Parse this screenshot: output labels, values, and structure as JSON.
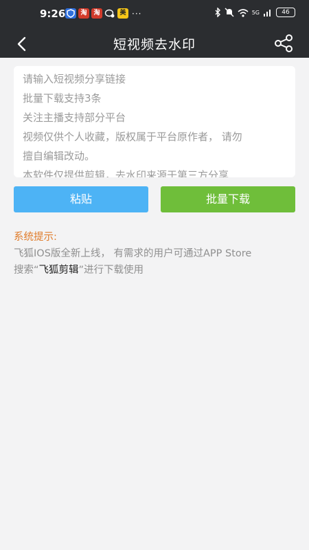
{
  "status_bar": {
    "time": "9:26",
    "apps": [
      {
        "icon": "shield-app-icon",
        "label": "",
        "color": "#2f6fdc"
      },
      {
        "icon": "taobao-app-icon",
        "label": "淘",
        "color": "#d23b2b"
      },
      {
        "icon": "taobao-app-icon-2",
        "label": "淘",
        "color": "#d23b2b"
      },
      {
        "icon": "chat-app-icon",
        "label": "",
        "color": "#2b2d30"
      },
      {
        "icon": "meituan-app-icon",
        "label": "美",
        "color": "#f5c518"
      }
    ],
    "more": "···",
    "network": "5G",
    "battery": "46"
  },
  "header": {
    "title": "短视频去水印"
  },
  "input": {
    "hint_lines": [
      "请输入短视频分享链接",
      "批量下载支持3条",
      "关注主播支持部分平台",
      "视频仅供个人收藏，版权属于平台原作者，  请勿",
      "擅自编辑改动。",
      "本软件仅提供剪辑，去水印来源于第三方分享"
    ]
  },
  "actions": {
    "paste_label": "粘贴",
    "batch_label": "批量下载"
  },
  "notice": {
    "title": "系统提示:",
    "line1": "飞狐IOS版全新上线，  有需求的用户可通过APP Store",
    "line2_prefix": "搜索“",
    "line2_link": "飞狐剪辑",
    "line2_suffix": "”进行下载使用"
  },
  "colors": {
    "bar": "#2b2d30",
    "paste": "#4db3f5",
    "batch": "#6fbe3a",
    "notice_title": "#e07c2b"
  }
}
